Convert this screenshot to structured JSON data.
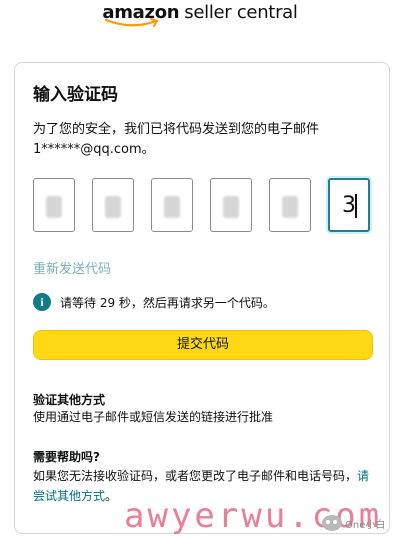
{
  "logo": {
    "amazon": "amazon",
    "seller_central": "seller central"
  },
  "card": {
    "title": "输入验证码",
    "description": "为了您的安全，我们已将代码发送到您的电子邮件 1******@qq.com。",
    "code_digits": [
      "",
      "",
      "",
      "",
      "",
      "3"
    ],
    "resend_link": "重新发送代码",
    "info_icon": "info-icon",
    "info_text": "请等待 29 秒，然后再请求另一个代码。",
    "submit_label": "提交代码",
    "other_method": {
      "heading": "验证其他方式",
      "text": "使用通过电子邮件或短信发送的链接进行批准"
    },
    "help": {
      "heading": "需要帮助吗?",
      "text_line1": "如果您无法接收验证码，或者您更改了电子邮件和电话号码，",
      "link_part1": "请",
      "link_part2": "尝试其他方式",
      "text_end": "。"
    }
  },
  "watermark": {
    "text": "awyerwu.com",
    "brand": "One小白"
  },
  "colors": {
    "button_yellow": "#ffd814",
    "link_teal": "#007185",
    "resend_disabled": "#7bb1ba",
    "info_icon_bg": "#137a8a",
    "active_focus": "#2b7a8b",
    "watermark_pink": "#e36a82"
  }
}
